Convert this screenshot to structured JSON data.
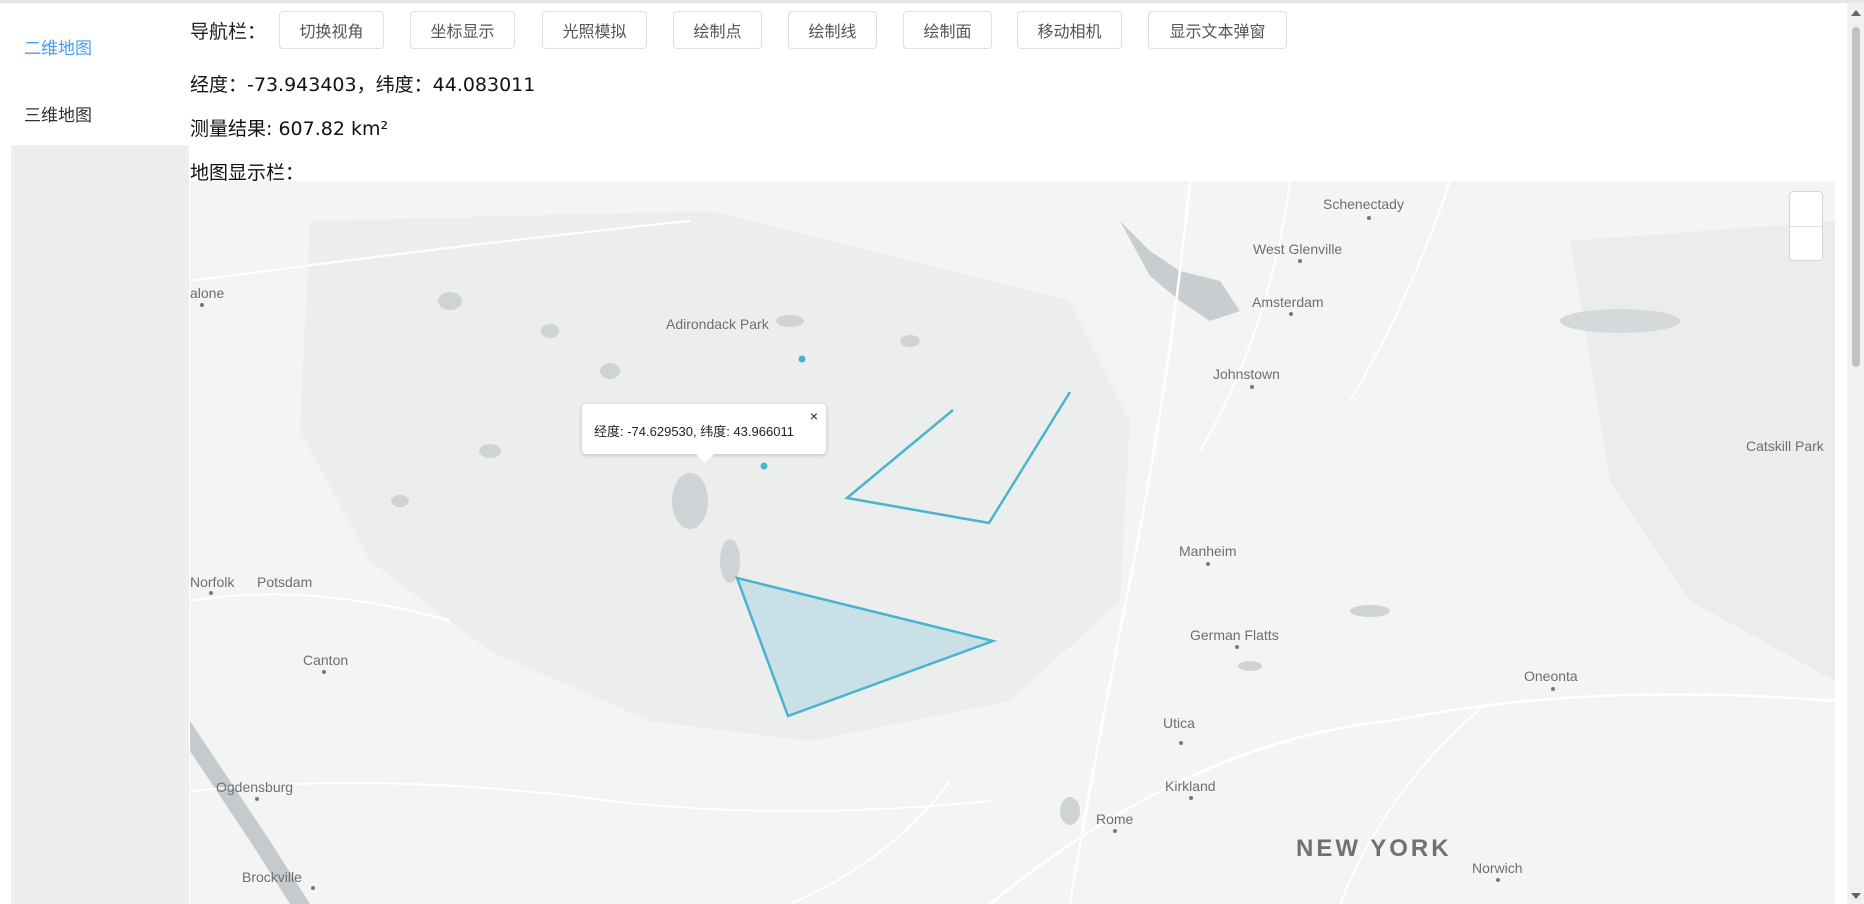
{
  "sidebar": {
    "items": [
      {
        "label": "二维地图",
        "active": true
      },
      {
        "label": "三维地图",
        "active": false
      }
    ]
  },
  "nav": {
    "label": "导航栏：",
    "buttons": [
      "切换视角",
      "坐标显示",
      "光照模拟",
      "绘制点",
      "绘制线",
      "绘制面",
      "移动相机",
      "显示文本弹窗"
    ]
  },
  "coords_text": "经度：-73.943403，纬度：44.083011",
  "measure_text": "测量结果: 607.82 km²",
  "map_label": "地图显示栏：",
  "map": {
    "popup": {
      "text": "经度: -74.629530, 纬度: 43.966011",
      "close": "×"
    },
    "places": [
      "Schenectady",
      "West Glenville",
      "Amsterdam",
      "alone",
      "Adirondack Park",
      "Johnstown",
      "Catskill Park",
      "Manheim",
      "Norfolk",
      "Potsdam",
      "German Flatts",
      "Canton",
      "Oneonta",
      "Utica",
      "Ogdensburg",
      "Kirkland",
      "Rome",
      "NEW YORK",
      "Brockville",
      "Norwich"
    ],
    "accent_color": "#4ab3cf"
  }
}
